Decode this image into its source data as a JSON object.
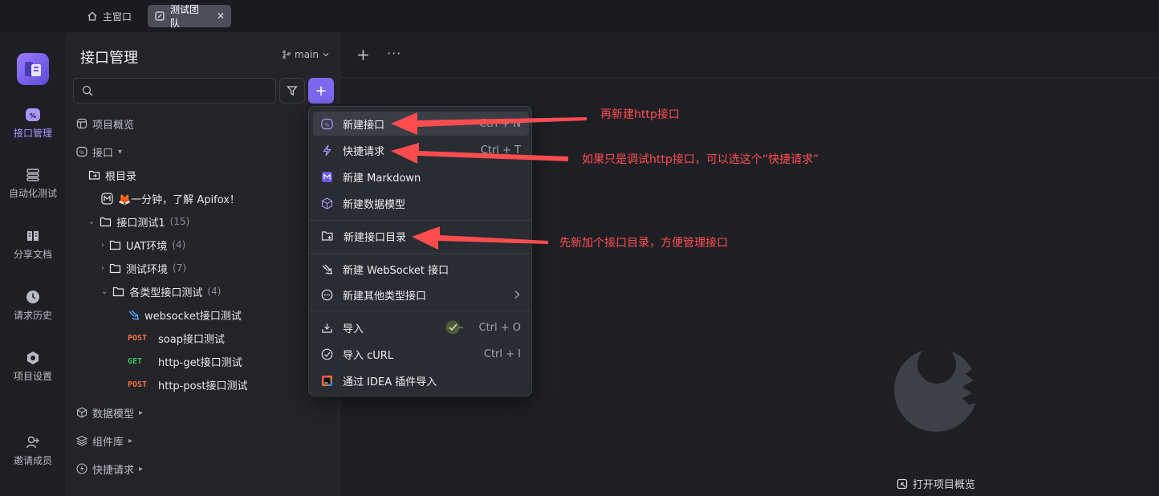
{
  "titlebar": {
    "tabs": [
      {
        "label": "主窗口",
        "icon": "home-icon"
      },
      {
        "label": "测试团队",
        "icon": "team-icon"
      }
    ],
    "close_glyph": "✕"
  },
  "rail": {
    "items": [
      {
        "label": "接口管理",
        "icon": "api-icon"
      },
      {
        "label": "自动化测试",
        "icon": "automation-icon"
      },
      {
        "label": "分享文档",
        "icon": "book-icon"
      },
      {
        "label": "请求历史",
        "icon": "clock-icon"
      },
      {
        "label": "项目设置",
        "icon": "settings-icon"
      },
      {
        "label": "邀请成员",
        "icon": "add-user-icon"
      }
    ]
  },
  "sidebar": {
    "title": "接口管理",
    "branch": "main",
    "search_placeholder": "",
    "overview": "项目概览",
    "api_section": "接口",
    "root": "根目录",
    "doc_item": "🦊一分钟，了解 Apifox！",
    "folder1": {
      "label": "接口测试1",
      "count": "(15)"
    },
    "sub_folders": [
      {
        "label": "UAT环境",
        "count": "(4)"
      },
      {
        "label": "测试环境",
        "count": "(7)"
      },
      {
        "label": "各类型接口测试",
        "count": "(4)"
      }
    ],
    "endpoints": [
      {
        "method": "",
        "label": "websocket接口测试",
        "icon": "websocket-icon"
      },
      {
        "method": "POST",
        "label": "soap接口测试",
        "color": "#f5703d"
      },
      {
        "method": "GET",
        "label": "http-get接口测试",
        "color": "#35c15e"
      },
      {
        "method": "POST",
        "label": "http-post接口测试",
        "color": "#f5703d"
      }
    ],
    "bottom": [
      {
        "label": "数据模型",
        "icon": "cube-icon"
      },
      {
        "label": "组件库",
        "icon": "layers-icon"
      },
      {
        "label": "快捷请求",
        "icon": "bolt-icon"
      }
    ]
  },
  "toolbar": {
    "add_glyph": "+",
    "more_glyph": "···"
  },
  "menu": {
    "items": [
      {
        "label": "新建接口",
        "shortcut": "Ctrl + N"
      },
      {
        "label": "快捷请求",
        "shortcut": "Ctrl + T"
      },
      {
        "label": "新建 Markdown",
        "shortcut": ""
      },
      {
        "label": "新建数据模型",
        "shortcut": ""
      },
      {
        "label": "新建接口目录",
        "shortcut": ""
      },
      {
        "label": "新建 WebSocket 接口",
        "shortcut": ""
      },
      {
        "label": "新建其他类型接口",
        "shortcut": ""
      },
      {
        "label": "导入",
        "shortcut": "Ctrl + O"
      },
      {
        "label": "导入 cURL",
        "shortcut": "Ctrl + I"
      },
      {
        "label": "通过 IDEA 插件导入",
        "shortcut": ""
      }
    ]
  },
  "annotations": [
    "再新建http接口",
    "如果只是调试http接口，可以选这个“快捷请求”",
    "先新加个接口目录，方便管理接口"
  ],
  "footer": {
    "open_overview": "打开项目概览"
  },
  "colors": {
    "accent": "#7b68ee",
    "annotation": "#ff4d4f",
    "post": "#f5703d",
    "get": "#35c15e"
  }
}
